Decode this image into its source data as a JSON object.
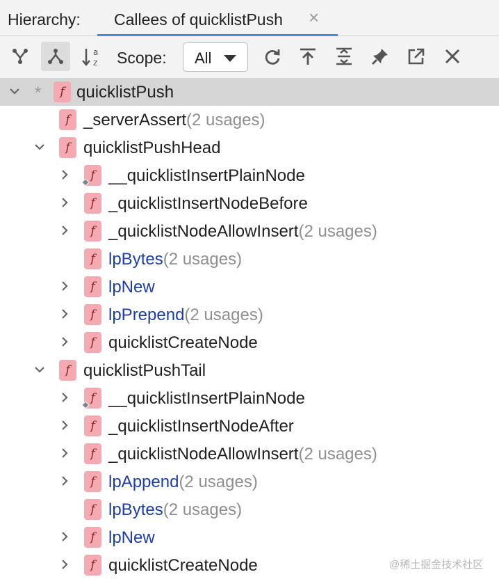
{
  "header": {
    "label": "Hierarchy:",
    "tab_title": "Callees of quicklistPush",
    "tab_close": "×"
  },
  "toolbar": {
    "scope_label": "Scope:",
    "scope_value": "All",
    "buttons": [
      "callers-hierarchy",
      "callees-hierarchy",
      "sort-alpha",
      "refresh",
      "export",
      "expand-all",
      "pin",
      "open-in-window",
      "close"
    ]
  },
  "tree": {
    "rows": [
      {
        "name": "quicklistPush",
        "usages": "",
        "lib": false
      },
      {
        "name": "_serverAssert",
        "usages": "(2 usages)",
        "lib": false
      },
      {
        "name": "quicklistPushHead",
        "usages": "",
        "lib": false
      },
      {
        "name": "__quicklistInsertPlainNode",
        "usages": "",
        "lib": false
      },
      {
        "name": "_quicklistInsertNodeBefore",
        "usages": "",
        "lib": false
      },
      {
        "name": "_quicklistNodeAllowInsert",
        "usages": "(2 usages)",
        "lib": false
      },
      {
        "name": "lpBytes",
        "usages": "(2 usages)",
        "lib": true
      },
      {
        "name": "lpNew",
        "usages": "",
        "lib": true
      },
      {
        "name": "lpPrepend",
        "usages": "(2 usages)",
        "lib": true
      },
      {
        "name": "quicklistCreateNode",
        "usages": "",
        "lib": false
      },
      {
        "name": "quicklistPushTail",
        "usages": "",
        "lib": false
      },
      {
        "name": "__quicklistInsertPlainNode",
        "usages": "",
        "lib": false
      },
      {
        "name": "_quicklistInsertNodeAfter",
        "usages": "",
        "lib": false
      },
      {
        "name": "_quicklistNodeAllowInsert",
        "usages": "(2 usages)",
        "lib": false
      },
      {
        "name": "lpAppend",
        "usages": "(2 usages)",
        "lib": true
      },
      {
        "name": "lpBytes",
        "usages": "(2 usages)",
        "lib": true
      },
      {
        "name": "lpNew",
        "usages": "",
        "lib": true
      },
      {
        "name": "quicklistCreateNode",
        "usages": "",
        "lib": false
      }
    ],
    "root_marker": "*",
    "icon_letter": "f"
  },
  "watermark": "@稀土掘金技术社区",
  "colors": {
    "accent": "#4a89dc",
    "function_icon_bg": "#f5aab2",
    "library_name": "#1d3ea8",
    "usage_text": "#8f8f8f",
    "selection": "#d5d5d5"
  }
}
